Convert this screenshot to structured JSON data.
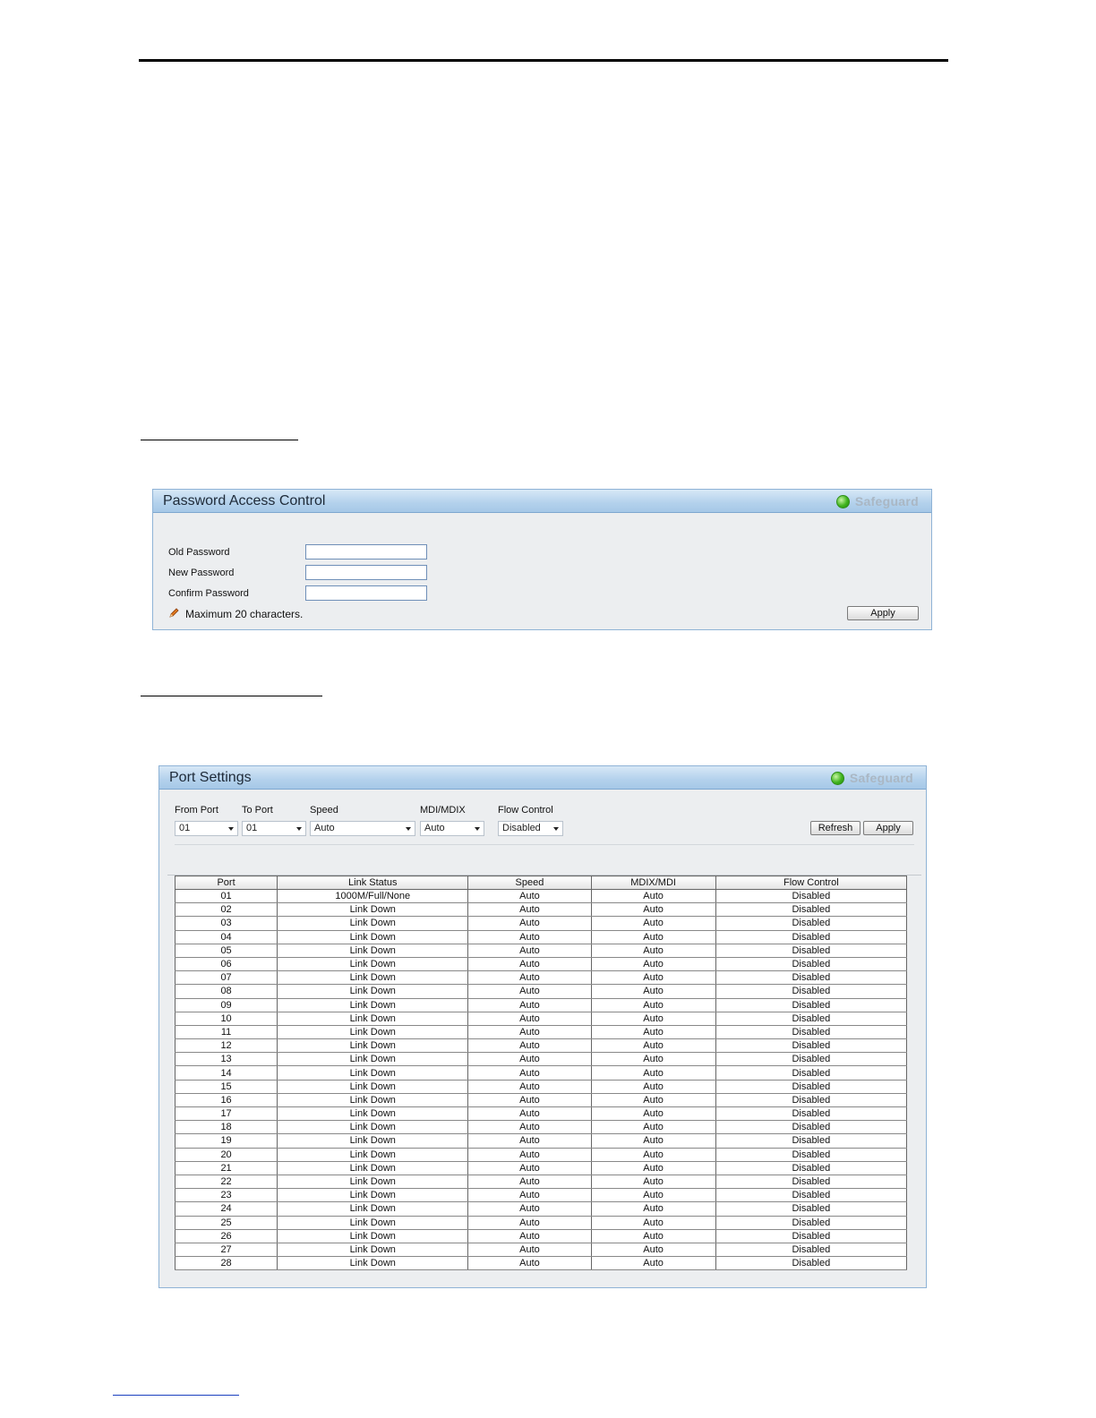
{
  "password_panel": {
    "title": "Password Access Control",
    "safeguard": "Safeguard",
    "old_password_label": "Old Password",
    "new_password_label": "New Password",
    "confirm_password_label": "Confirm Password",
    "hint": "Maximum 20 characters.",
    "apply": "Apply"
  },
  "port_panel": {
    "title": "Port Settings",
    "safeguard": "Safeguard",
    "from_port_label": "From Port",
    "from_port_value": "01",
    "to_port_label": "To Port",
    "to_port_value": "01",
    "speed_label": "Speed",
    "speed_value": "Auto",
    "mdi_label": "MDI/MDIX",
    "mdi_value": "Auto",
    "flow_label": "Flow Control",
    "flow_value": "Disabled",
    "refresh": "Refresh",
    "apply": "Apply",
    "columns": [
      "Port",
      "Link Status",
      "Speed",
      "MDIX/MDI",
      "Flow Control"
    ],
    "rows": [
      [
        "01",
        "1000M/Full/None",
        "Auto",
        "Auto",
        "Disabled"
      ],
      [
        "02",
        "Link Down",
        "Auto",
        "Auto",
        "Disabled"
      ],
      [
        "03",
        "Link Down",
        "Auto",
        "Auto",
        "Disabled"
      ],
      [
        "04",
        "Link Down",
        "Auto",
        "Auto",
        "Disabled"
      ],
      [
        "05",
        "Link Down",
        "Auto",
        "Auto",
        "Disabled"
      ],
      [
        "06",
        "Link Down",
        "Auto",
        "Auto",
        "Disabled"
      ],
      [
        "07",
        "Link Down",
        "Auto",
        "Auto",
        "Disabled"
      ],
      [
        "08",
        "Link Down",
        "Auto",
        "Auto",
        "Disabled"
      ],
      [
        "09",
        "Link Down",
        "Auto",
        "Auto",
        "Disabled"
      ],
      [
        "10",
        "Link Down",
        "Auto",
        "Auto",
        "Disabled"
      ],
      [
        "11",
        "Link Down",
        "Auto",
        "Auto",
        "Disabled"
      ],
      [
        "12",
        "Link Down",
        "Auto",
        "Auto",
        "Disabled"
      ],
      [
        "13",
        "Link Down",
        "Auto",
        "Auto",
        "Disabled"
      ],
      [
        "14",
        "Link Down",
        "Auto",
        "Auto",
        "Disabled"
      ],
      [
        "15",
        "Link Down",
        "Auto",
        "Auto",
        "Disabled"
      ],
      [
        "16",
        "Link Down",
        "Auto",
        "Auto",
        "Disabled"
      ],
      [
        "17",
        "Link Down",
        "Auto",
        "Auto",
        "Disabled"
      ],
      [
        "18",
        "Link Down",
        "Auto",
        "Auto",
        "Disabled"
      ],
      [
        "19",
        "Link Down",
        "Auto",
        "Auto",
        "Disabled"
      ],
      [
        "20",
        "Link Down",
        "Auto",
        "Auto",
        "Disabled"
      ],
      [
        "21",
        "Link Down",
        "Auto",
        "Auto",
        "Disabled"
      ],
      [
        "22",
        "Link Down",
        "Auto",
        "Auto",
        "Disabled"
      ],
      [
        "23",
        "Link Down",
        "Auto",
        "Auto",
        "Disabled"
      ],
      [
        "24",
        "Link Down",
        "Auto",
        "Auto",
        "Disabled"
      ],
      [
        "25",
        "Link Down",
        "Auto",
        "Auto",
        "Disabled"
      ],
      [
        "26",
        "Link Down",
        "Auto",
        "Auto",
        "Disabled"
      ],
      [
        "27",
        "Link Down",
        "Auto",
        "Auto",
        "Disabled"
      ],
      [
        "28",
        "Link Down",
        "Auto",
        "Auto",
        "Disabled"
      ]
    ],
    "dimmed_mdi_from_port": "25"
  },
  "colors": {
    "header_blue": "#b3d1ec",
    "panel_bg": "#eceef0",
    "safeguard_green": "#3fb31d",
    "safeguard_text": "#aab7c4",
    "dimmed_text": "#a9a9a9"
  }
}
